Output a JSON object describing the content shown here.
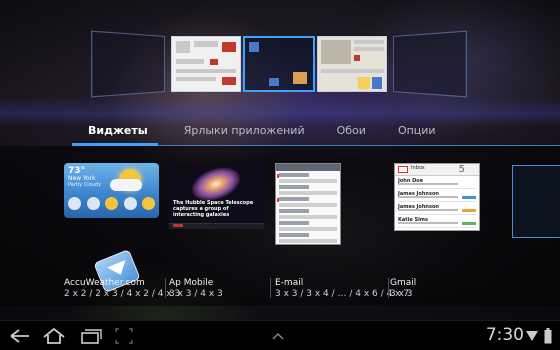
{
  "tabs": [
    {
      "label": "Виджеты",
      "active": true
    },
    {
      "label": "Ярлыки приложений",
      "active": false
    },
    {
      "label": "Обои",
      "active": false
    },
    {
      "label": "Опции",
      "active": false
    }
  ],
  "widgets": [
    {
      "name": "AccuWeather.com",
      "sizes": "2 x 2 / 2 x 3 / 4 x 2 / 4 x 3",
      "preview": {
        "temp": "73°",
        "city": "New York",
        "desc": "Partly Cloudy"
      }
    },
    {
      "name": "Ap Mobile",
      "sizes": "3 x 3 / 4 x 3",
      "preview": {
        "caption": "The Hubble Space Telescope captures a group of interacting galaxies"
      }
    },
    {
      "name": "E-mail",
      "sizes": "3 x 3 / 3 x 4 / … / 4 x 6 / 4 x 7"
    },
    {
      "name": "Gmail",
      "sizes": "3 x 3",
      "preview": {
        "title": "Inbox",
        "count": "5",
        "rows": [
          "John Doe",
          "James Johnson",
          "James Johnson",
          "Katie Sims"
        ]
      }
    }
  ],
  "status_bar": {
    "time": "7:30"
  },
  "icons": {
    "back": "back-arrow-icon",
    "home": "home-icon",
    "recent": "recent-apps-icon",
    "screenshot": "screenshot-icon",
    "up": "chevron-up-icon",
    "wifi": "wifi-icon",
    "battery": "battery-icon"
  },
  "colors": {
    "accent": "#3fa2ff",
    "tab_rule": "#3a7fc2"
  }
}
